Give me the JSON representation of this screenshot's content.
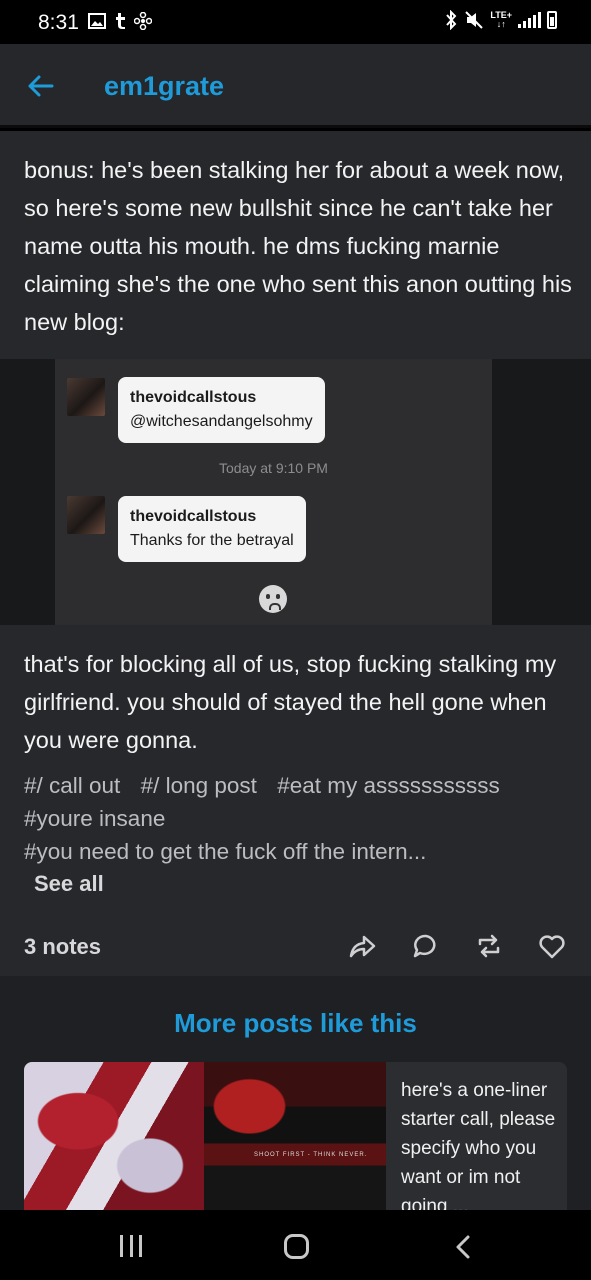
{
  "status_bar": {
    "time": "8:31",
    "left_icons": [
      "image-icon",
      "tumblr-icon",
      "pinwheel-icon"
    ],
    "right_icons": [
      "bluetooth-icon",
      "mute-icon",
      "lte-icon",
      "signal-icon",
      "battery-icon"
    ],
    "lte_label": "LTE+"
  },
  "header": {
    "back_icon": "arrow-left-icon",
    "blog_name": "em1grate"
  },
  "post": {
    "paragraph_1": "bonus:  he's been stalking her for about a week now,  so here's some new bullshit since he can't take her name outta his mouth.  he dms fucking marnie claiming she's the one who sent this anon outting his new blog:",
    "dm_screenshot": {
      "message_1_user": "thevoidcallstous",
      "message_1_text": "@witchesandangelsohmy",
      "timestamp": "Today at 9:10 PM",
      "message_2_user": "thevoidcallstous",
      "message_2_text": "Thanks for the betrayal",
      "reaction_icon": "sad-face-icon"
    },
    "paragraph_2": "that's for blocking all of us,  stop fucking stalking my girlfriend.  you should of stayed the hell gone when you were gonna.",
    "tags": [
      "#/ call out",
      "#/ long post",
      "#eat my asssssssssss",
      "#youre insane",
      "#you need to get the fuck off the intern..."
    ],
    "see_all": "See all",
    "notes": "3 notes",
    "actions": [
      "share-icon",
      "reply-icon",
      "reblog-icon",
      "like-icon"
    ]
  },
  "more_posts": {
    "title": "More posts like this",
    "card_text": "here's a one-liner starter call, please specify who you want or im not going ...",
    "thumb2_caption": "SHOOT FIRST - THINK NEVER."
  },
  "navbar": {
    "icons": [
      "recent-apps-icon",
      "home-icon",
      "back-icon"
    ]
  },
  "colors": {
    "accent": "#1f9bd9",
    "post_bg": "#26282c",
    "header_bg": "#25272b"
  }
}
